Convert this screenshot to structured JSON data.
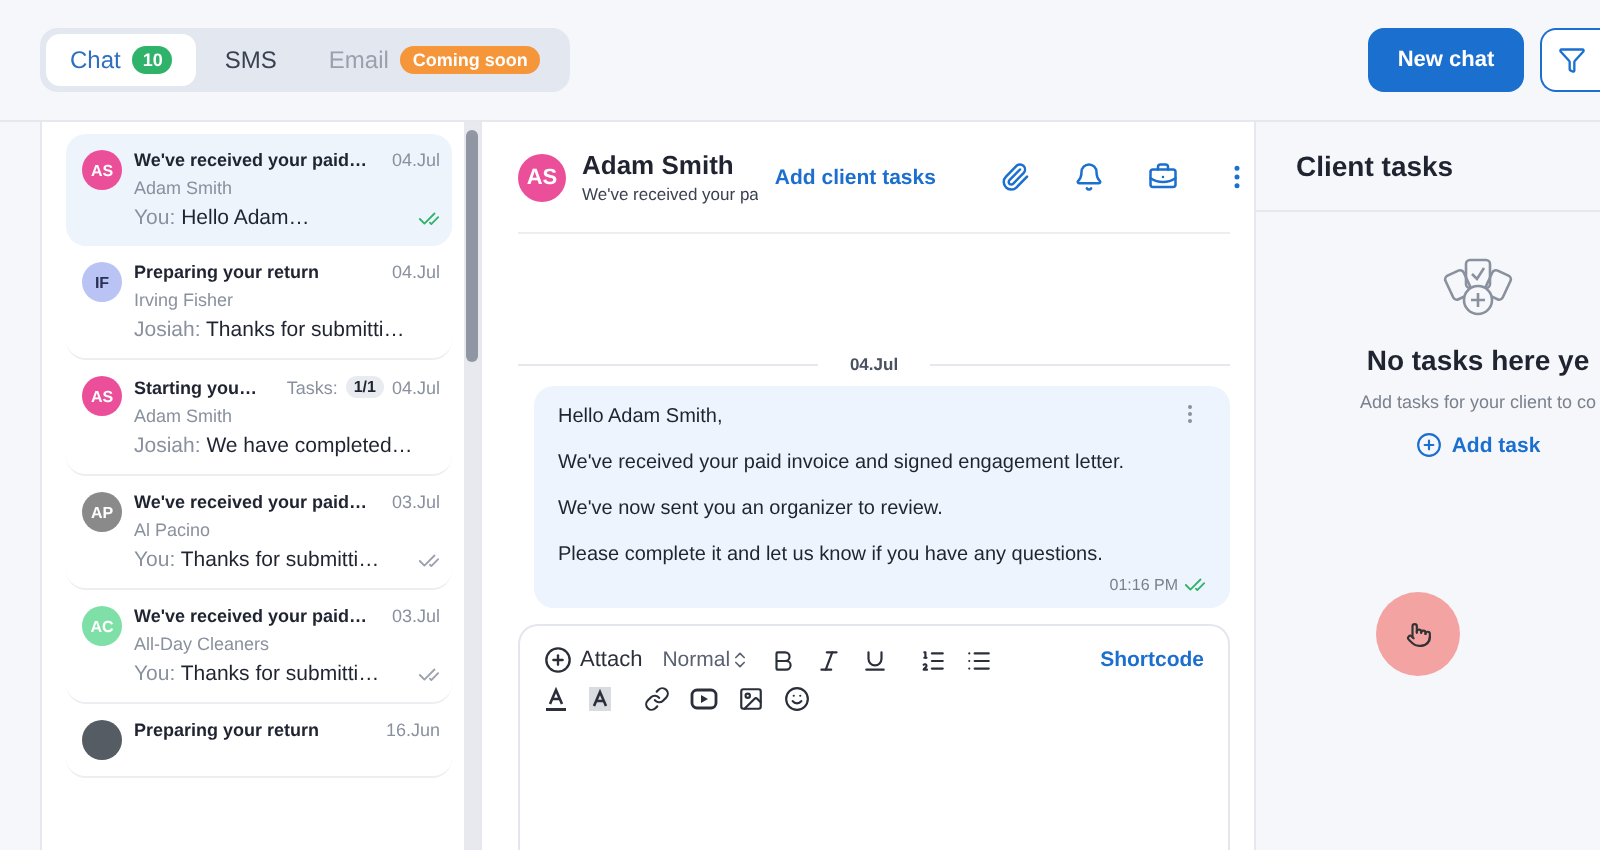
{
  "channel_tabs": [
    {
      "label": "Chat",
      "count": "10",
      "selected": true,
      "disabled": false
    },
    {
      "label": "SMS",
      "selected": false,
      "disabled": false
    },
    {
      "label": "Email",
      "badge": "Coming soon",
      "selected": false,
      "disabled": true
    }
  ],
  "new_chat_button": "New chat",
  "conversations": [
    {
      "kind": "initials",
      "initials": "AS",
      "color": "#ec4f9a",
      "title": "We've received your paid…",
      "date": "04.Jul",
      "contact": "Adam Smith",
      "sender": "You:",
      "preview": "Hello Adam…",
      "read": true,
      "selected": true
    },
    {
      "kind": "initials",
      "initials": "IF",
      "color": "#b9c3f4",
      "title": "Preparing your return",
      "date": "04.Jul",
      "contact": "Irving Fisher",
      "sender": "Josiah:",
      "preview": "Thanks for submitti…",
      "selected": false
    },
    {
      "kind": "initials",
      "initials": "AS",
      "color": "#ec4f9a",
      "title": "Starting you…",
      "tasks_label": "Tasks:",
      "tasks": "1/1",
      "date": "04.Jul",
      "contact": "Adam Smith",
      "sender": "Josiah:",
      "preview": "We have completed…",
      "selected": false
    },
    {
      "kind": "initials",
      "initials": "AP",
      "color": "#8a8a8a",
      "title": "We've received your paid…",
      "date": "03.Jul",
      "contact": "Al Pacino",
      "sender": "You:",
      "preview": "Thanks for submitti…",
      "read": false,
      "selected": false
    },
    {
      "kind": "initials",
      "initials": "AC",
      "color": "#7ee0a6",
      "title": "We've received your paid…",
      "date": "03.Jul",
      "contact": "All-Day Cleaners",
      "sender": "You:",
      "preview": "Thanks for submitti…",
      "read": false,
      "selected": false
    },
    {
      "kind": "photo",
      "title": "Preparing your return",
      "date": "16.Jun",
      "selected": false
    }
  ],
  "chat": {
    "initials": "AS",
    "color": "#ec4f9a",
    "name": "Adam Smith",
    "subtitle": "We've received your pa",
    "add_tasks_link": "Add client tasks",
    "date_divider": "04.Jul",
    "message": {
      "paragraphs": [
        "Hello Adam Smith,",
        "We've received your paid invoice and signed engagement letter.",
        "We've now sent you an organizer to review.",
        "Please complete it and let us know if you have any questions."
      ],
      "time": "01:16 PM",
      "read": true
    },
    "editor": {
      "attach": "Attach",
      "format": "Normal",
      "shortcode": "Shortcode"
    }
  },
  "client_tasks": {
    "title": "Client tasks",
    "empty_title": "No tasks here ye",
    "empty_text": "Add tasks for your client to co",
    "add_task": "Add task"
  }
}
